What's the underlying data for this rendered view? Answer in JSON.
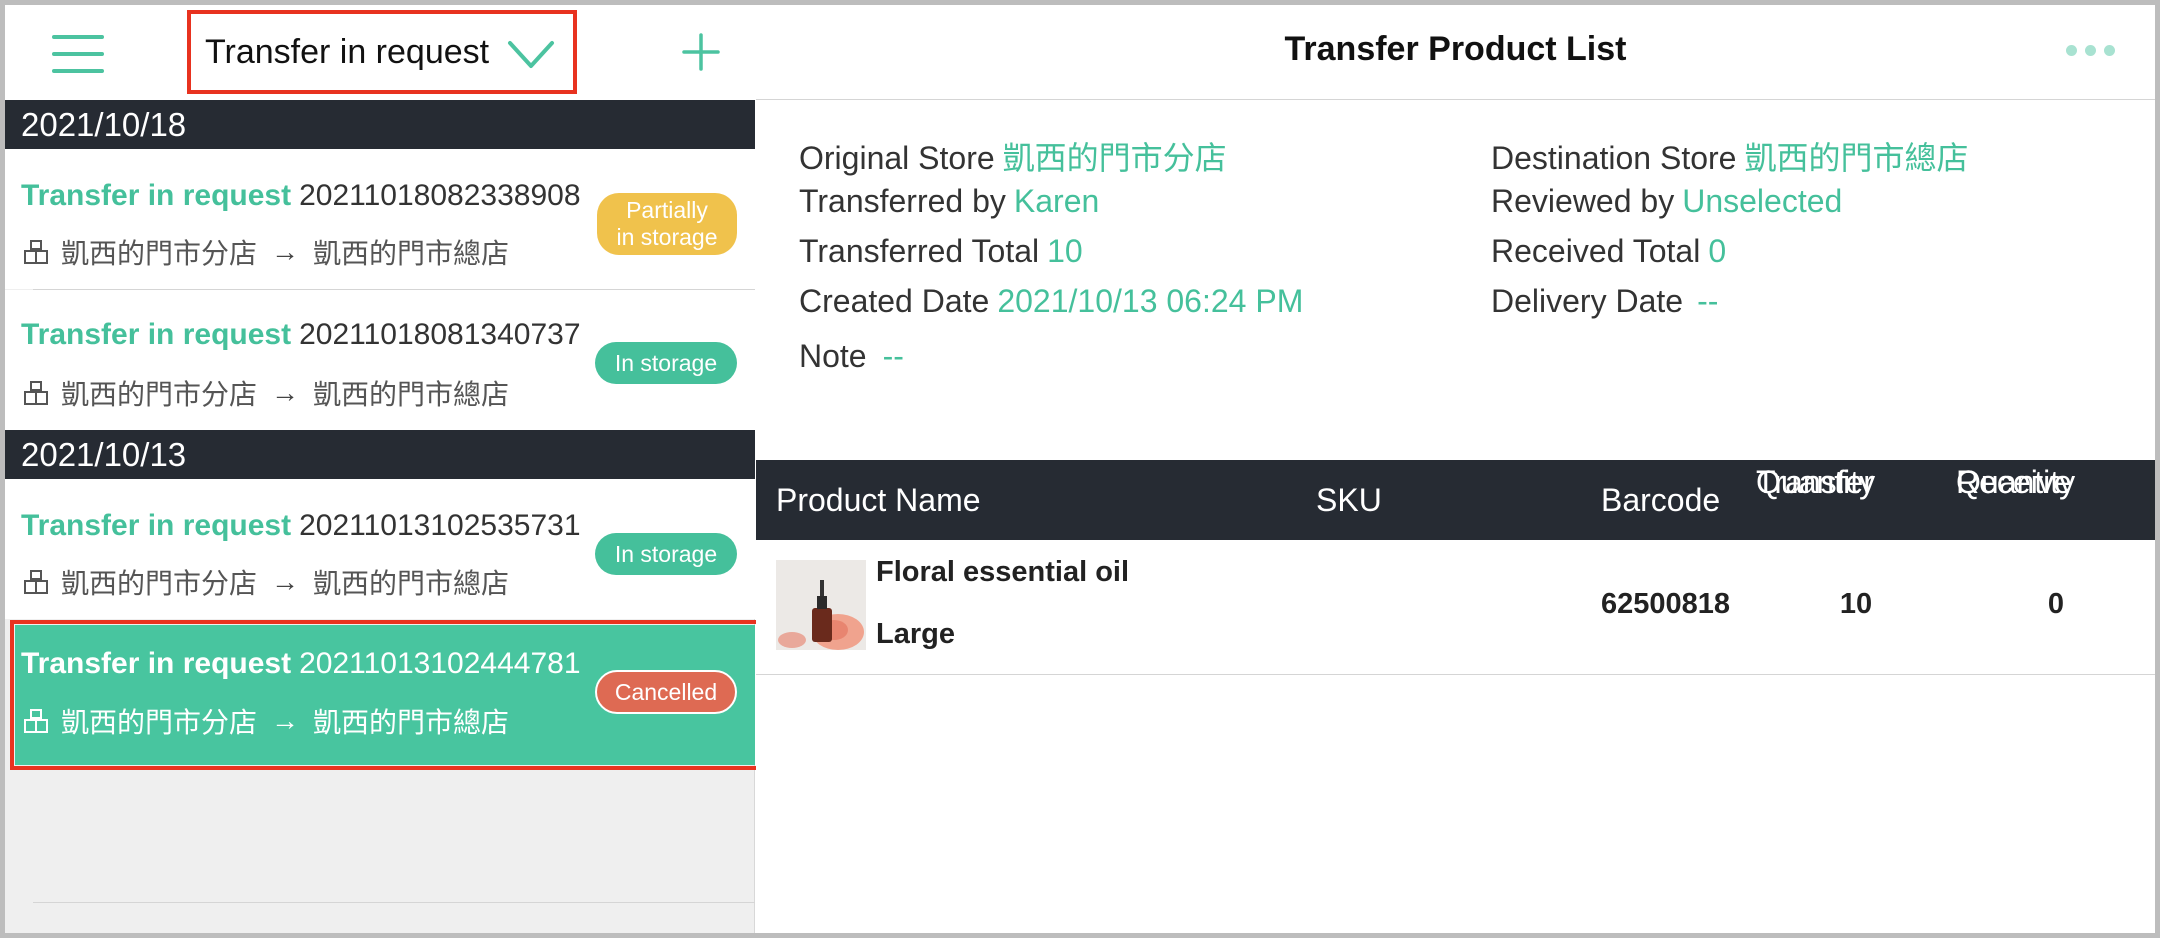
{
  "left_header": {
    "filter_label": "Transfer in request"
  },
  "groups": [
    {
      "date": "2021/10/18",
      "items": [
        {
          "type": "Transfer in request",
          "number": "20211018082338908",
          "from": "凱西的門市分店",
          "to": "凱西的門市總店",
          "status_line1": "Partially",
          "status_line2": "in storage",
          "status_color": "#f0c24c"
        },
        {
          "type": "Transfer in request",
          "number": "20211018081340737",
          "from": "凱西的門市分店",
          "to": "凱西的門市總店",
          "status": "In storage",
          "status_color": "#45c09b"
        }
      ]
    },
    {
      "date": "2021/10/13",
      "items": [
        {
          "type": "Transfer in request",
          "number": "20211013102535731",
          "from": "凱西的門市分店",
          "to": "凱西的門市總店",
          "status": "In storage",
          "status_color": "#45c09b"
        },
        {
          "type": "Transfer in request",
          "number": "20211013102444781",
          "from": "凱西的門市分店",
          "to": "凱西的門市總店",
          "status": "Cancelled",
          "status_color": "#de6a53",
          "selected": true
        }
      ]
    }
  ],
  "arrow": "→",
  "detail": {
    "title": "Transfer Product List",
    "original_store_label": "Original Store",
    "original_store": "凱西的門市分店",
    "destination_store_label": "Destination Store",
    "destination_store": "凱西的門市總店",
    "transferred_by_label": "Transferred by",
    "transferred_by": "Karen",
    "reviewed_by_label": "Reviewed by",
    "reviewed_by": "Unselected",
    "transferred_total_label": "Transferred Total",
    "transferred_total": "10",
    "received_total_label": "Received Total",
    "received_total": "0",
    "created_date_label": "Created Date",
    "created_date": "2021/10/13 06:24 PM",
    "delivery_date_label": "Delivery Date",
    "delivery_date": "--",
    "note_label": "Note",
    "note": "--"
  },
  "table": {
    "headers": {
      "product_name": "Product Name",
      "sku": "SKU",
      "barcode": "Barcode",
      "transfer_qty_1": "Transfer",
      "transfer_qty_2": "Quantity",
      "receive_qty_1": "Receive",
      "receive_qty_2": "Quantity"
    },
    "rows": [
      {
        "name": "Floral essential oil",
        "variant": "Large",
        "sku": "",
        "barcode": "62500818",
        "transfer_qty": "10",
        "receive_qty": "0"
      }
    ]
  },
  "colors": {
    "accent": "#45c09b",
    "dark_header": "#262b33",
    "highlight_border": "#e8321f"
  }
}
